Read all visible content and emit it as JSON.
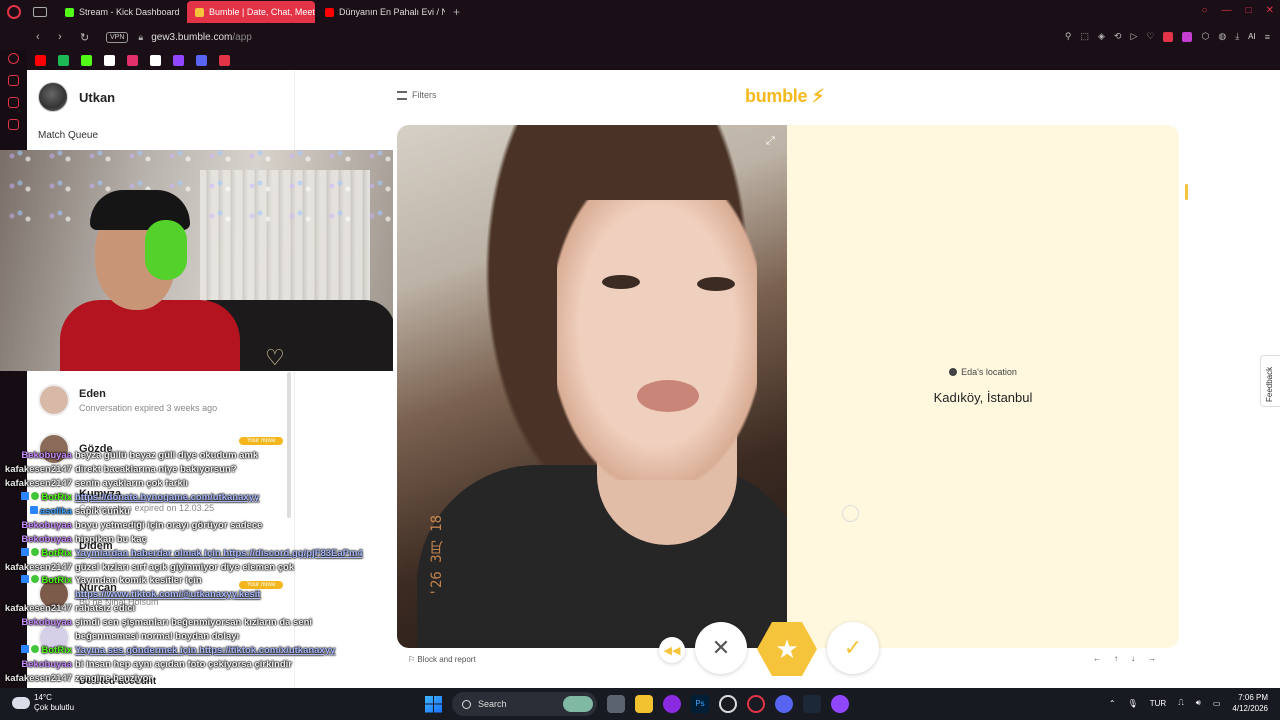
{
  "browser": {
    "tabs": [
      {
        "label": "Stream - Kick Dashboard",
        "color": "#53fc18",
        "active": false
      },
      {
        "label": "Bumble | Date, Chat, Meet",
        "color": "#f5c43a",
        "active": true
      },
      {
        "label": "Dünyanın En Pahalı Evi / N",
        "color": "#ff0000",
        "active": false
      }
    ],
    "vpn_label": "VPN",
    "url_host": "gew3.bumble.com",
    "url_path": "/app",
    "ai_label": "AI",
    "bookmarks": [
      {
        "icon": "youtube-icon",
        "color": "#ff0000"
      },
      {
        "icon": "spotify-icon",
        "color": "#1db954"
      },
      {
        "icon": "kick-icon",
        "color": "#53fc18"
      },
      {
        "icon": "x-icon",
        "color": "#ffffff"
      },
      {
        "icon": "instagram-icon",
        "color": "#e1306c"
      },
      {
        "icon": "tiktok-icon",
        "color": "#ffffff"
      },
      {
        "icon": "twitch-icon",
        "color": "#9146ff"
      },
      {
        "icon": "discord-icon",
        "color": "#5865f2"
      },
      {
        "icon": "gift-icon",
        "color": "#e23347"
      }
    ]
  },
  "sidebar": {
    "profile_name": "Utkan",
    "match_queue_label": "Match Queue",
    "conversations": [
      {
        "name": "Eden",
        "sub": "Conversation expired 3 weeks ago",
        "your_move": false
      },
      {
        "name": "Gözde",
        "sub": "",
        "your_move": true
      },
      {
        "name": "Kumyza",
        "sub": "Conversation expired on 12.03.25",
        "your_move": false
      },
      {
        "name": "Didem",
        "sub": "",
        "your_move": false
      },
      {
        "name": "Nurcan",
        "sub": "Bu ne Nihal Holsum",
        "your_move": true
      }
    ],
    "your_move_label": "Your move",
    "deleted_label": "Deleted account"
  },
  "chat": [
    {
      "user": "Bekobuyaa",
      "color": "#c88bff",
      "msg": "beyza güllü beyaz güll diye okudum amk",
      "link": false,
      "badges": []
    },
    {
      "user": "kafakesen2147",
      "color": "#e8e8e8",
      "msg": "direkt bacaklarına niye bakıyorsun?",
      "link": false,
      "badges": []
    },
    {
      "user": "kafakesen2147",
      "color": "#e8e8e8",
      "msg": "senin ayakların çok farklı",
      "link": false,
      "badges": []
    },
    {
      "user": "BotRix",
      "color": "#53fc18",
      "msg": "https://donate.bynogame.com/utkanaxyy",
      "link": true,
      "badges": [
        "bot",
        "dot"
      ]
    },
    {
      "user": "asolika",
      "color": "#3aa0ff",
      "msg": "sapık cunku",
      "link": false,
      "badges": [
        "bot"
      ]
    },
    {
      "user": "Bekobuyaa",
      "color": "#c88bff",
      "msg": "boyu yetmediği için orayı görüyor sadece",
      "link": false,
      "badges": []
    },
    {
      "user": "Bekobuyaa",
      "color": "#c88bff",
      "msg": "hippikan bu kaç",
      "link": false,
      "badges": []
    },
    {
      "user": "BotRix",
      "color": "#53fc18",
      "msg": "Yayınlardan haberdar olmak için https://discord.gg/pjF83EaPm4",
      "link": true,
      "badges": [
        "bot",
        "dot"
      ]
    },
    {
      "user": "kafakesen2147",
      "color": "#e8e8e8",
      "msg": "güzel kızları sırf açık giyinmiyor diye elemen çok",
      "link": false,
      "badges": []
    },
    {
      "user": "BotRix",
      "color": "#53fc18",
      "msg": "Yayından komik kesitler için",
      "link": false,
      "badges": [
        "bot",
        "dot"
      ]
    },
    {
      "user": "",
      "color": "#e8e8e8",
      "msg": "https://www.tiktok.com/@utkanaxyy.kesit",
      "link": true,
      "badges": []
    },
    {
      "user": "kafakesen2147",
      "color": "#e8e8e8",
      "msg": "rahatsız edici",
      "link": false,
      "badges": []
    },
    {
      "user": "Bekobuyaa",
      "color": "#c88bff",
      "msg": "şimdi sen şişmanları beğenmiyorsan kızların da seni",
      "link": false,
      "badges": []
    },
    {
      "user": "",
      "color": "#e8e8e8",
      "msg": "beğenmemesi normal boydan dolayı",
      "link": false,
      "badges": []
    },
    {
      "user": "BotRix",
      "color": "#53fc18",
      "msg": "Yayına ses göndermek için https://tiktok.com/x/utkanaxyy",
      "link": true,
      "badges": [
        "bot",
        "dot"
      ]
    },
    {
      "user": "Bekobuyaa",
      "color": "#c88bff",
      "msg": "bi insan hep aynı açıdan foto çekiyorsa çirkindir",
      "link": false,
      "badges": []
    },
    {
      "user": "kafakesen2147",
      "color": "#e8e8e8",
      "msg": "zengine benziyor",
      "link": false,
      "badges": []
    }
  ],
  "bumble": {
    "filters_label": "Filters",
    "logo_text": "bumble",
    "location_label": "Eda's location",
    "location_value": "Kadıköy, İstanbul",
    "photo_stamp": "'26 3月 18",
    "block_report_label": "Block and report",
    "accent_color": "#f5c43a",
    "feedback_label": "Feedback"
  },
  "taskbar": {
    "temperature": "14°C",
    "weather_text": "Çok bulutlu",
    "search_label": "Search",
    "language": "TUR",
    "time": "7:06 PM",
    "date": "4/12/2026"
  }
}
